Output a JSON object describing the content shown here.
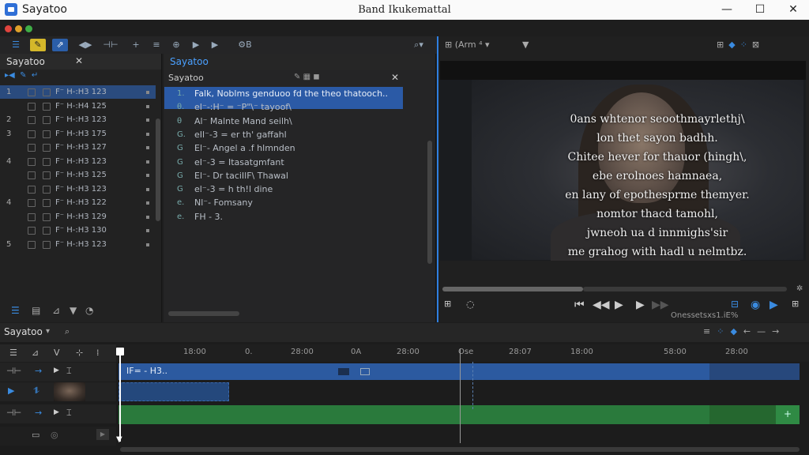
{
  "window": {
    "app_name": "Sayatoo",
    "title": "Band Ikukemattal",
    "min": "—",
    "max": "☐",
    "close": "✕"
  },
  "left_panel": {
    "title": "Sayatoo",
    "close": "✕",
    "rows": [
      {
        "num": "1",
        "text": "F⁻ H-:H3 123",
        "selected": true
      },
      {
        "num": "",
        "text": "F⁻ H-:H4 125",
        "selected": false
      },
      {
        "num": "2",
        "text": "F⁻ H-:H3 123",
        "selected": false
      },
      {
        "num": "3",
        "text": "F⁻ H-:H3 175",
        "selected": false
      },
      {
        "num": "",
        "text": "F⁻ H-:H3 127",
        "selected": false
      },
      {
        "num": "4",
        "text": "F⁻ H-:H3 123",
        "selected": false
      },
      {
        "num": "",
        "text": "F⁻ H-:H3 125",
        "selected": false
      },
      {
        "num": "",
        "text": "F⁻ H-:H3 123",
        "selected": false
      },
      {
        "num": "4",
        "text": "F⁻ H-:H3 122",
        "selected": false
      },
      {
        "num": "",
        "text": "F⁻ H-:H3 129",
        "selected": false
      },
      {
        "num": "",
        "text": "F⁻ H-:H3 130",
        "selected": false
      },
      {
        "num": "5",
        "text": "F⁻ H-:H3 123",
        "selected": false
      }
    ]
  },
  "subtitle_panel": {
    "title": "Sayatoo",
    "tab": "Sayatoo",
    "rows": [
      {
        "tag": "1.",
        "text": "Falk, Noblms genduoo fd the theo thatooch..",
        "selected": true
      },
      {
        "tag": "θ.",
        "text": "eI⁻-:H⁻ = ⁻P\"\\⁻ tayoof\\",
        "selected": false
      },
      {
        "tag": "θ",
        "text": "Al⁻ Malnte Mand seilh\\",
        "selected": false
      },
      {
        "tag": "G.",
        "text": "eIl⁻-3 = er th' gaffahl",
        "selected": false
      },
      {
        "tag": "G",
        "text": "El⁻- Angel a .f hlmnden",
        "selected": false
      },
      {
        "tag": "G",
        "text": "eI⁻-3 = Itasatgmfant",
        "selected": false
      },
      {
        "tag": "G",
        "text": "El⁻- Dr taciIlF\\ Thawal",
        "selected": false
      },
      {
        "tag": "G",
        "text": "el⁻-3 = h th!l dine",
        "selected": false
      },
      {
        "tag": "e.",
        "text": "Nl⁻- Fomsany",
        "selected": false
      },
      {
        "tag": "e.",
        "text": "FH - 3.",
        "selected": false
      }
    ]
  },
  "viewer": {
    "header": "⊞ (Arm ⁴ ▾",
    "subtitles": [
      "0ans whtenor seoothmayrlethj\\",
      "lon thet sayon badhh.",
      "Chitee hever for thauor (hingh\\,",
      "ebe erolnoes hamnaea,",
      "en lany of epothesprme themyer.",
      "nomtor thacd tamohl,",
      "jwneoh ua d innmighs'sir",
      "me grahog with hadl u nelmtbz."
    ],
    "status": "Onessetsxs1.iE%"
  },
  "timeline": {
    "title": "Sayatoo",
    "ruler": [
      "18:00",
      "0.",
      "28:00",
      "0A",
      "28:00",
      "Ose",
      "28:07",
      "18:00",
      "58:00",
      "28:00"
    ],
    "clip_label": "IF= - H3.."
  },
  "colors": {
    "accent": "#2f7fe0",
    "selected_row": "#2b5aa6",
    "video_clip": "#2c5aa0",
    "audio_clip": "#2a7a3c"
  }
}
